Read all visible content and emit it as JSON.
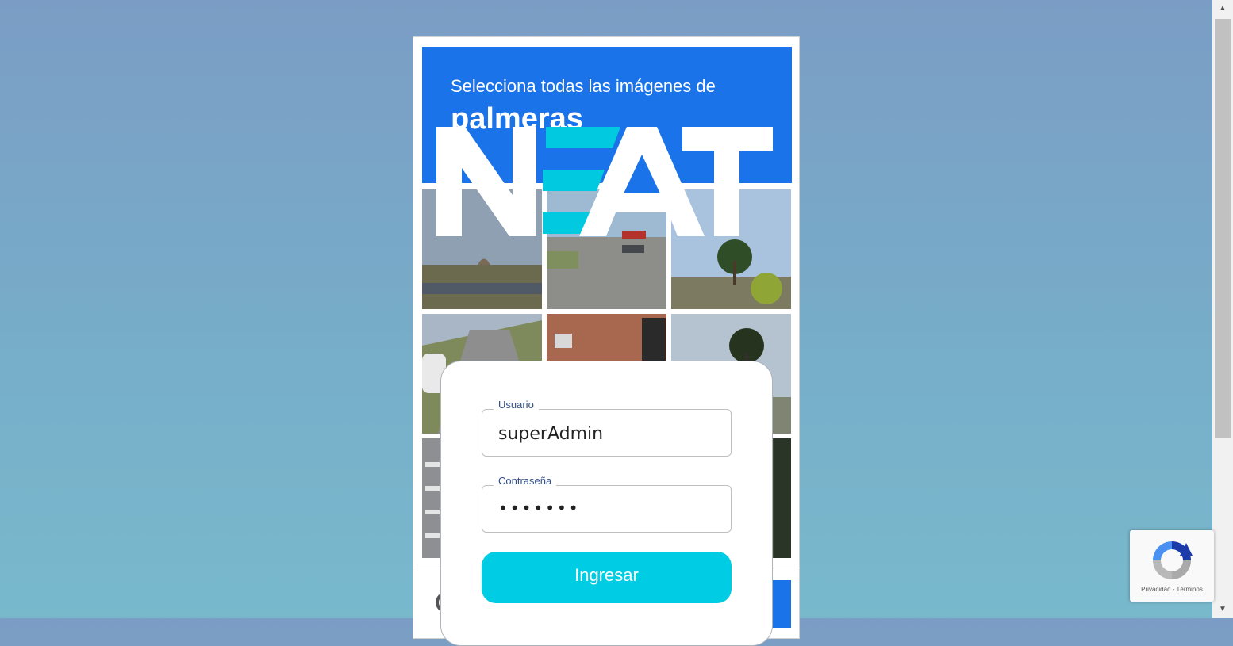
{
  "captcha": {
    "instruction": "Selecciona todas las imágenes de",
    "keyword": "palmeras"
  },
  "logo": {
    "text": "NEAT",
    "letters": [
      "N",
      "E",
      "A",
      "T"
    ],
    "accent_color": "#00c9e0"
  },
  "login": {
    "username_label": "Usuario",
    "username_value": "superAdmin",
    "password_label": "Contraseña",
    "password_value": "•••••••",
    "submit_label": "Ingresar"
  },
  "recaptcha": {
    "terms": "Privacidad - Términos"
  },
  "colors": {
    "captcha_blue": "#1a73e8",
    "button_cyan": "#00cce3",
    "label_blue": "#33508a"
  }
}
